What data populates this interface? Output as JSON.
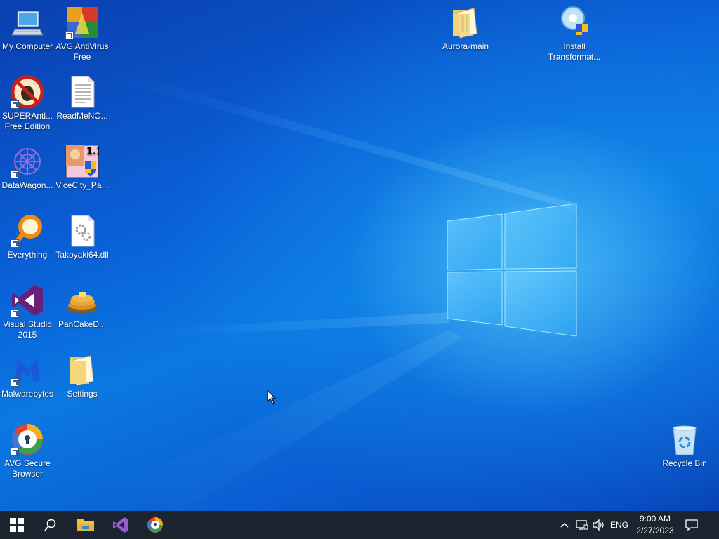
{
  "desktop": {
    "icons": [
      {
        "label": "My Computer",
        "icon": "computer-icon"
      },
      {
        "label": "AVG AntiVirus Free",
        "icon": "avg-antivirus-icon"
      },
      {
        "label": "SUPERAnti... Free Edition",
        "icon": "superantispyware-icon"
      },
      {
        "label": "ReadMeNO...",
        "icon": "text-file-icon"
      },
      {
        "label": "DataWagon...",
        "icon": "datawagon-icon"
      },
      {
        "label": "ViceCity_Pa...",
        "icon": "vicecity-installer-icon"
      },
      {
        "label": "Everything",
        "icon": "everything-search-icon"
      },
      {
        "label": "Takoyaki64.dll",
        "icon": "dll-file-icon"
      },
      {
        "label": "Visual Studio 2015",
        "icon": "visual-studio-icon"
      },
      {
        "label": "PanCakeD...",
        "icon": "pancake-icon"
      },
      {
        "label": "Malwarebytes",
        "icon": "malwarebytes-icon"
      },
      {
        "label": "Settings",
        "icon": "folder-icon"
      },
      {
        "label": "AVG Secure Browser",
        "icon": "avg-secure-browser-icon"
      },
      {
        "label": "Aurora-main",
        "icon": "folder-icon"
      },
      {
        "label": "Install Transformat...",
        "icon": "installer-icon"
      },
      {
        "label": "Recycle Bin",
        "icon": "recycle-bin-icon"
      }
    ]
  },
  "taskbar": {
    "pinned": [
      "start-icon",
      "search-icon",
      "file-explorer-icon",
      "visual-studio-icon",
      "avg-secure-browser-icon"
    ],
    "tray": {
      "language": "ENG",
      "time": "9:00 AM",
      "date": "2/27/2023"
    }
  },
  "colors": {
    "desktop_blue": "#0a5fd6",
    "taskbar": "#1c2430"
  }
}
